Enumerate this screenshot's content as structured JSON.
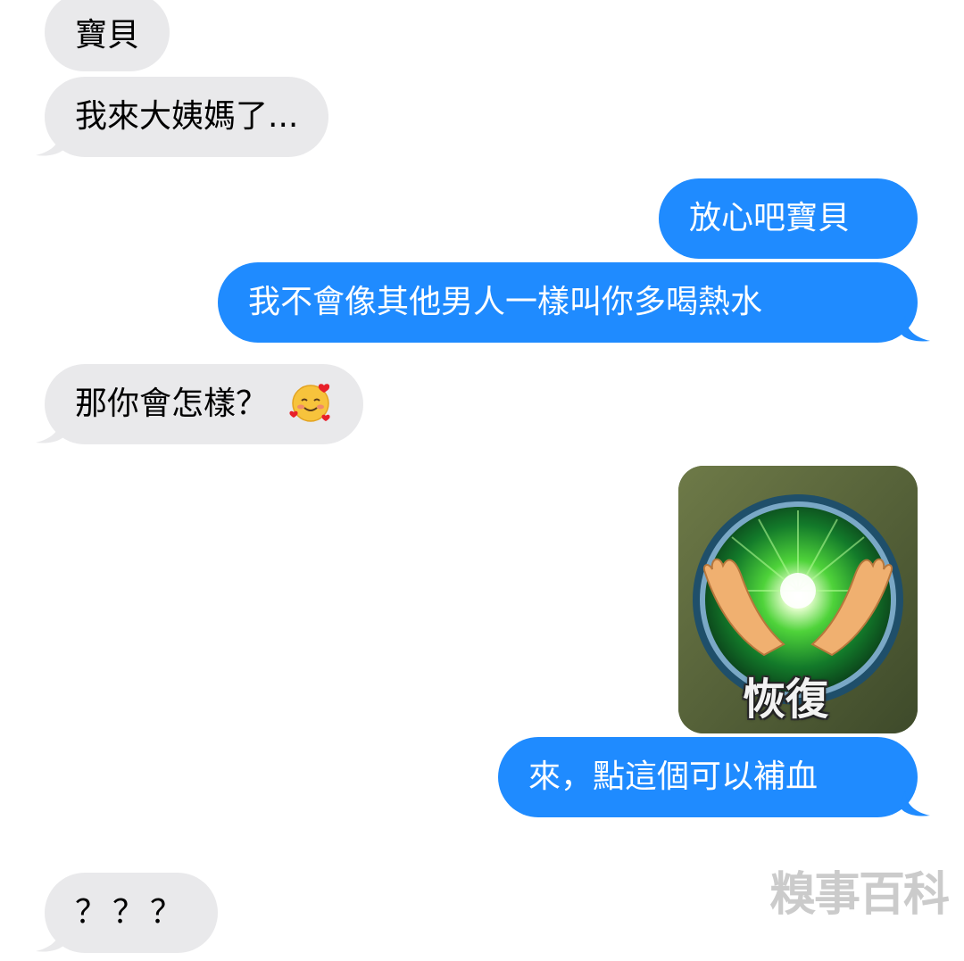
{
  "messages": [
    {
      "side": "received",
      "text": "寶貝"
    },
    {
      "side": "received",
      "text": "我來大姨媽了..."
    },
    {
      "side": "sent",
      "text": "放心吧寶貝"
    },
    {
      "side": "sent",
      "text": "我不會像其他男人一樣叫你多喝熱水"
    },
    {
      "side": "received",
      "text": "那你會怎樣？",
      "emoji": "smiling-face-with-hearts-icon"
    },
    {
      "side": "sent",
      "type": "sticker",
      "label": "恢復",
      "icon": "healing-hands-icon"
    },
    {
      "side": "sent",
      "text": "來，點這個可以補血"
    },
    {
      "side": "received",
      "text": "？？？"
    }
  ],
  "watermark": "糗事百科",
  "colors": {
    "received_bubble": "#e9e9eb",
    "sent_bubble": "#1f8bff",
    "received_text": "#000000",
    "sent_text": "#ffffff"
  }
}
